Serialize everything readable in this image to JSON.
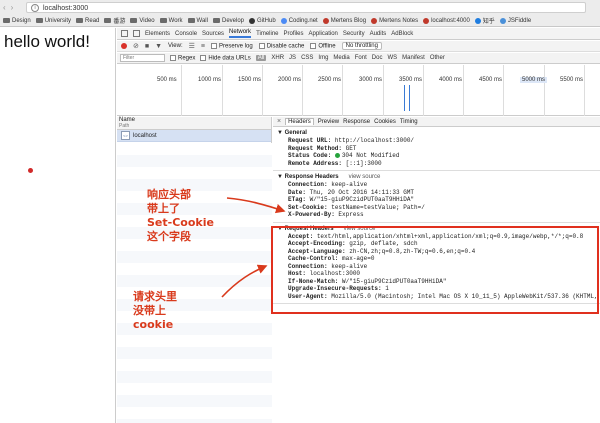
{
  "browser": {
    "url": "localhost:3000",
    "bookmarks": [
      {
        "label": "Design",
        "type": "folder"
      },
      {
        "label": "University",
        "type": "folder"
      },
      {
        "label": "Read",
        "type": "folder"
      },
      {
        "label": "番游",
        "type": "folder"
      },
      {
        "label": "Video",
        "type": "folder"
      },
      {
        "label": "Work",
        "type": "folder"
      },
      {
        "label": "Wall",
        "type": "folder"
      },
      {
        "label": "Develop",
        "type": "folder"
      },
      {
        "label": "GitHub",
        "type": "fav",
        "color": "#333333"
      },
      {
        "label": "Coding.net",
        "type": "fav",
        "color": "#4c8bf5"
      },
      {
        "label": "Mertens Blog",
        "type": "fav",
        "color": "#c0392b"
      },
      {
        "label": "Mertens Notes",
        "type": "fav",
        "color": "#c0392b"
      },
      {
        "label": "localhost:4000",
        "type": "fav",
        "color": "#c0392b"
      },
      {
        "label": "知乎",
        "type": "fav",
        "color": "#1e7de0"
      },
      {
        "label": "JSFiddle",
        "type": "fav",
        "color": "#4a90d9"
      }
    ]
  },
  "page": {
    "heading": "hello world!"
  },
  "devtools": {
    "tabs": [
      "Elements",
      "Console",
      "Sources",
      "Network",
      "Timeline",
      "Profiles",
      "Application",
      "Security",
      "Audits",
      "AdBlock"
    ],
    "active_tab": "Network",
    "toolbar": {
      "view_label": "View:",
      "preserve_log": "Preserve log",
      "disable_cache": "Disable cache",
      "offline": "Offline",
      "throttling": "No throttling"
    },
    "filter": {
      "placeholder": "Filter",
      "regex": "Regex",
      "hide_data_urls": "Hide data URLs",
      "types": [
        "All",
        "XHR",
        "JS",
        "CSS",
        "Img",
        "Media",
        "Font",
        "Doc",
        "WS",
        "Manifest",
        "Other"
      ],
      "active_type": "All"
    },
    "overview_ticks": [
      "500 ms",
      "1000 ms",
      "1500 ms",
      "2000 ms",
      "2500 ms",
      "3000 ms",
      "3500 ms",
      "4000 ms",
      "4500 ms",
      "5000 ms",
      "5500 ms"
    ],
    "overview_highlight": "5000 ms",
    "list": {
      "col_name": "Name",
      "col_path": "Path",
      "request_name": "localhost"
    },
    "detail_tabs": [
      "Headers",
      "Preview",
      "Response",
      "Cookies",
      "Timing"
    ],
    "active_detail_tab": "Headers",
    "general": {
      "title": "General",
      "rows": [
        {
          "k": "Request URL:",
          "v": "http://localhost:3000/"
        },
        {
          "k": "Request Method:",
          "v": "GET"
        },
        {
          "k": "Status Code:",
          "v": "304 Not Modified"
        },
        {
          "k": "Remote Address:",
          "v": "[::1]:3000"
        }
      ]
    },
    "response_headers": {
      "title": "Response Headers",
      "view_source": "view source",
      "rows": [
        {
          "k": "Connection:",
          "v": "keep-alive"
        },
        {
          "k": "Date:",
          "v": "Thu, 20 Oct 2016 14:11:33 GMT"
        },
        {
          "k": "ETag:",
          "v": "W/\"15-giuP9CzidPUT0aaT9HHiDA\""
        },
        {
          "k": "Set-Cookie:",
          "v": "testName=testValue; Path=/"
        },
        {
          "k": "X-Powered-By:",
          "v": "Express"
        }
      ]
    },
    "request_headers": {
      "title": "Request Headers",
      "view_source": "view source",
      "rows": [
        {
          "k": "Accept:",
          "v": "text/html,application/xhtml+xml,application/xml;q=0.9,image/webp,*/*;q=0.8"
        },
        {
          "k": "Accept-Encoding:",
          "v": "gzip, deflate, sdch"
        },
        {
          "k": "Accept-Language:",
          "v": "zh-CN,zh;q=0.8,zh-TW;q=0.6,en;q=0.4"
        },
        {
          "k": "Cache-Control:",
          "v": "max-age=0"
        },
        {
          "k": "Connection:",
          "v": "keep-alive"
        },
        {
          "k": "Host:",
          "v": "localhost:3000"
        },
        {
          "k": "If-None-Match:",
          "v": "W/\"15-giuP9CzidPUT0aaT9HHiDA\""
        },
        {
          "k": "Upgrade-Insecure-Requests:",
          "v": "1"
        },
        {
          "k": "User-Agent:",
          "v": "Mozilla/5.0 (Macintosh; Intel Mac OS X 10_11_5) AppleWebKit/537.36 (KHTML, l"
        }
      ]
    }
  },
  "annotations": {
    "response_note": [
      "响应头部",
      "带上了",
      "Set-Cookie",
      "这个字段"
    ],
    "request_note": [
      "请求头里",
      "没带上",
      "cookie"
    ],
    "color": "#d93a1c"
  }
}
